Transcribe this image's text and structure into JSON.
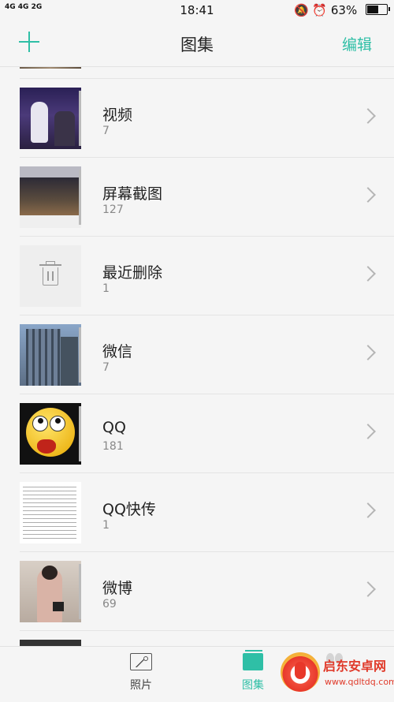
{
  "status_bar": {
    "network": "4G 4G 2G",
    "time": "18:41",
    "battery": "63%",
    "battery_level": 0.63
  },
  "header": {
    "add_icon": "plus-icon",
    "title": "图集",
    "edit_label": "编辑"
  },
  "albums": [
    {
      "name": "视频",
      "count": "7"
    },
    {
      "name": "屏幕截图",
      "count": "127"
    },
    {
      "name": "最近删除",
      "count": "1"
    },
    {
      "name": "微信",
      "count": "7"
    },
    {
      "name": "QQ",
      "count": "181"
    },
    {
      "name": "QQ快传",
      "count": "1"
    },
    {
      "name": "微博",
      "count": "69"
    }
  ],
  "bottom_nav": {
    "photos_label": "照片",
    "albums_label": "图集",
    "accent_color": "#2fbfa6"
  },
  "watermark": {
    "name": "启东安卓网",
    "url": "www.qdltdq.com"
  }
}
